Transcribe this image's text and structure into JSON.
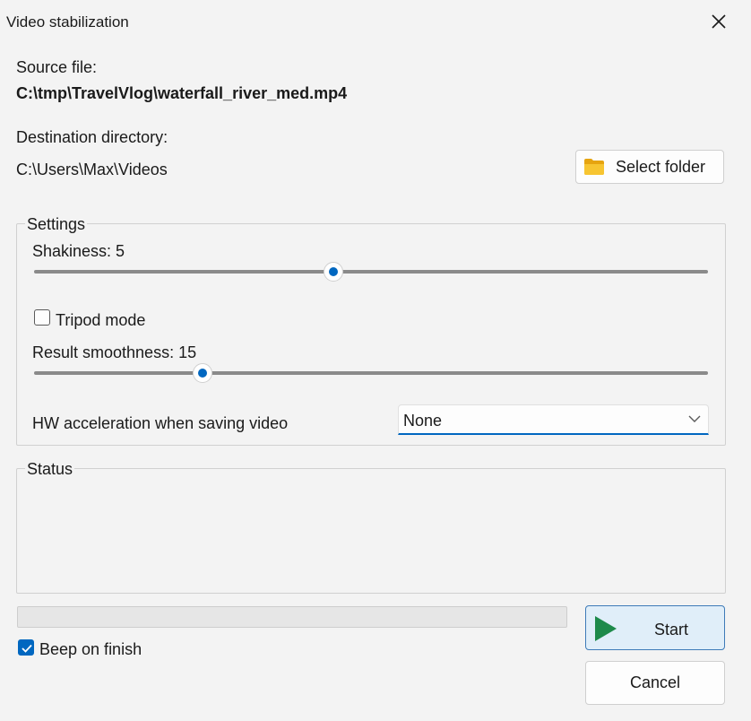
{
  "window": {
    "title": "Video stabilization"
  },
  "source": {
    "label": "Source file:",
    "path": "C:\\tmp\\TravelVlog\\waterfall_river_med.mp4"
  },
  "destination": {
    "label": "Destination directory:",
    "path": "C:\\Users\\Max\\Videos",
    "select_label": "Select folder"
  },
  "settings": {
    "legend": "Settings",
    "shakiness": {
      "label": "Shakiness: 5",
      "value": 5,
      "min": 1,
      "max": 10
    },
    "tripod": {
      "label": "Tripod mode",
      "checked": false
    },
    "smoothness": {
      "label": "Result smoothness: 15",
      "value": 15,
      "min": 0,
      "max": 60
    },
    "hw": {
      "label": "HW acceleration when saving video",
      "selected": "None"
    }
  },
  "status": {
    "legend": "Status"
  },
  "progress": {
    "value": 0
  },
  "beep": {
    "label": "Beep on finish",
    "checked": true
  },
  "buttons": {
    "start": "Start",
    "cancel": "Cancel"
  },
  "colors": {
    "accent": "#0067c0",
    "start_play": "#1e8a4a",
    "folder": "#f2b820"
  },
  "icons": {
    "close": "close-icon",
    "folder": "folder-icon",
    "play": "play-icon",
    "chevron": "chevron-down-icon",
    "check": "checkmark-icon"
  }
}
